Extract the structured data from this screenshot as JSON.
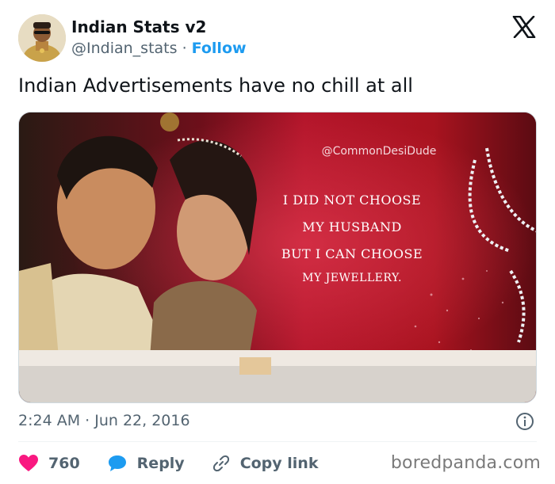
{
  "author": {
    "display_name": "Indian Stats v2",
    "handle": "@Indian_stats",
    "separator": "·",
    "follow_label": "Follow"
  },
  "post": {
    "text": "Indian Advertisements have no chill at all",
    "timestamp": "2:24 AM · Jun 22, 2016"
  },
  "media": {
    "watermark": "@CommonDesiDude",
    "ad_lines": [
      "I did not choose",
      "My husband",
      "But I can choose",
      "my Jewellery."
    ]
  },
  "actions": {
    "like_count": "760",
    "reply_label": "Reply",
    "copy_link_label": "Copy link"
  },
  "credit": "boredpanda.com",
  "colors": {
    "link": "#1d9bf0",
    "like_heart": "#f91880",
    "reply_bubble": "#1d9bf0",
    "muted_text": "#536471",
    "ad_background": "#a3101f"
  },
  "icons": [
    "avatar",
    "x-logo-icon",
    "info-icon",
    "heart-icon",
    "reply-icon",
    "link-icon"
  ]
}
